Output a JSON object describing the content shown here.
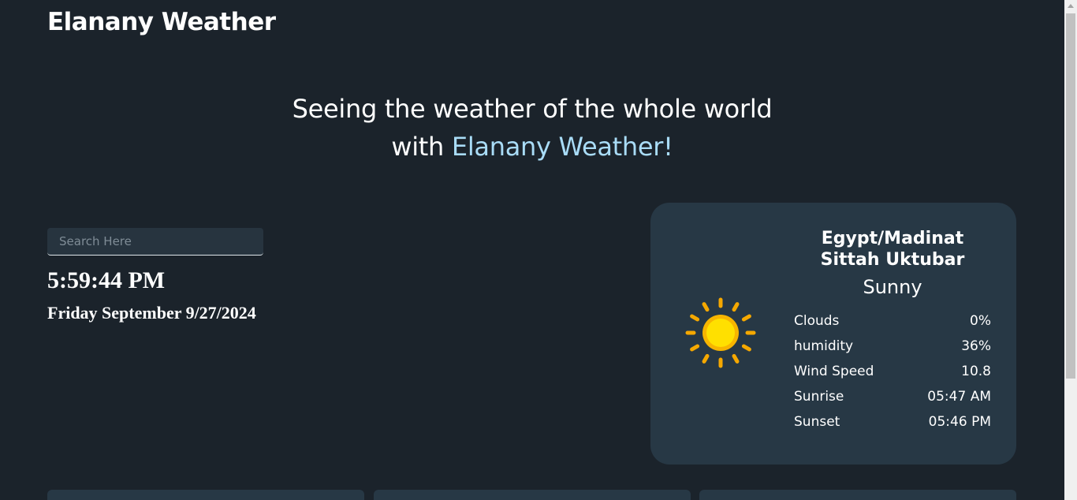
{
  "header": {
    "brand": "Elanany Weather"
  },
  "hero": {
    "line1": "Seeing the weather of the whole world",
    "line2_prefix": "with ",
    "line2_accent": "Elanany Weather!"
  },
  "search": {
    "placeholder": "Search Here",
    "value": ""
  },
  "clock": {
    "time": "5:59:44 PM",
    "date": "Friday September 9/27/2024"
  },
  "weather": {
    "location_line1": "Egypt/Madinat",
    "location_line2": "Sittah Uktubar",
    "condition": "Sunny",
    "icon": "sun-icon",
    "stats": [
      {
        "label": "Clouds",
        "value": "0%"
      },
      {
        "label": "humidity",
        "value": "36%"
      },
      {
        "label": "Wind Speed",
        "value": "10.8"
      },
      {
        "label": "Sunrise",
        "value": "05:47 AM"
      },
      {
        "label": "Sunset",
        "value": "05:46 PM"
      }
    ]
  },
  "colors": {
    "background": "#1b232b",
    "card": "#273845",
    "accent": "#a9dcf7",
    "sun_core": "#ffe000",
    "sun_ray": "#f5a800"
  }
}
